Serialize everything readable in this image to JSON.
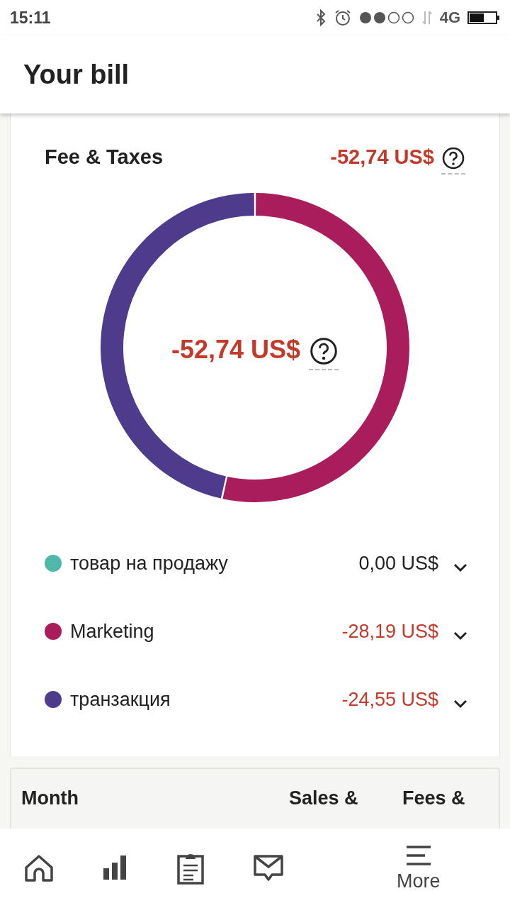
{
  "status_bar": {
    "time": "15:11",
    "network": "4G"
  },
  "header": {
    "title": "Your bill"
  },
  "summary": {
    "title": "Fee & Taxes",
    "total": "-52,74 US$",
    "center_total": "-52,74 US$",
    "chart_data": {
      "type": "donut",
      "categories": [
        "товар на продажу",
        "Marketing",
        "транзакция"
      ],
      "values": [
        0,
        53.45,
        46.55
      ]
    }
  },
  "legend": [
    {
      "amount": "0,00 US$",
      "color": "#4fb8a8",
      "negative": false,
      "expanded": false
    },
    {
      "amount": "-28,19 US$",
      "color": "#a91d5c",
      "negative": true,
      "expanded": false
    },
    {
      "amount": "-24,55 US$",
      "color": "#4f3b8b",
      "negative": true,
      "expanded": false
    }
  ],
  "table": {
    "columns": [
      "Month",
      "Sales &",
      "Fees &"
    ]
  },
  "bottom_nav": [
    {
      "kind": "home"
    },
    {
      "kind": "stats"
    },
    {
      "kind": "clipboard"
    },
    {
      "kind": "mail"
    },
    {
      "kind": "menu",
      "label": "More"
    }
  ]
}
